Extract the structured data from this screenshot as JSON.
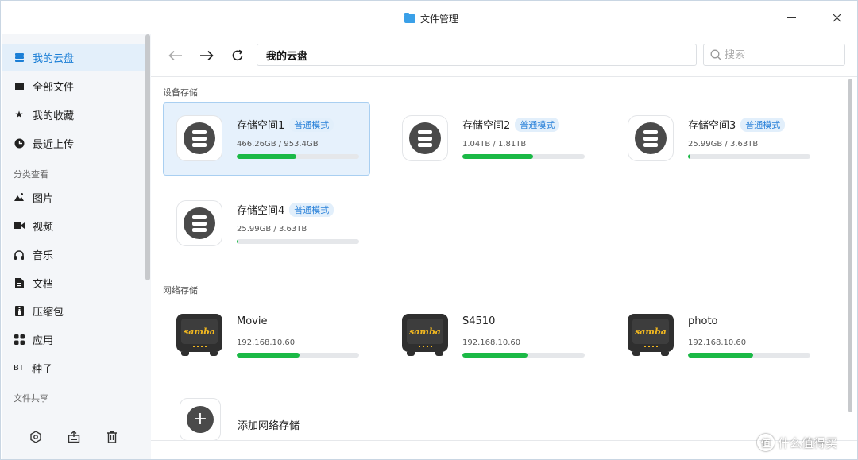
{
  "window": {
    "title": "文件管理"
  },
  "sidebar": {
    "items": [
      {
        "label": "我的云盘",
        "icon": "cloud-drive-icon",
        "active": true
      },
      {
        "label": "全部文件",
        "icon": "folder-icon"
      },
      {
        "label": "我的收藏",
        "icon": "star-icon"
      },
      {
        "label": "最近上传",
        "icon": "clock-icon"
      }
    ],
    "category_title": "分类查看",
    "categories": [
      {
        "label": "图片",
        "icon": "image-icon"
      },
      {
        "label": "视频",
        "icon": "video-icon"
      },
      {
        "label": "音乐",
        "icon": "headphones-icon"
      },
      {
        "label": "文档",
        "icon": "document-icon"
      },
      {
        "label": "压缩包",
        "icon": "archive-icon"
      },
      {
        "label": "应用",
        "icon": "apps-icon"
      },
      {
        "label": "种子",
        "icon": "torrent-icon",
        "icon_text": "BT"
      }
    ],
    "share_title": "文件共享"
  },
  "toolbar": {
    "path": "我的云盘",
    "search_placeholder": "搜索"
  },
  "device_section": {
    "label": "设备存储",
    "badge": "普通模式",
    "cards": [
      {
        "name": "存储空间1",
        "size": "466.26GB / 953.4GB",
        "usage": 0.49,
        "selected": true
      },
      {
        "name": "存储空间2",
        "size": "1.04TB / 1.81TB",
        "usage": 0.58
      },
      {
        "name": "存储空间3",
        "size": "25.99GB / 3.63TB",
        "usage": 0.01
      },
      {
        "name": "存储空间4",
        "size": "25.99GB / 3.63TB",
        "usage": 0.01
      }
    ]
  },
  "network_section": {
    "label": "网络存储",
    "logo_text": "samba",
    "cards": [
      {
        "name": "Movie",
        "ip": "192.168.10.60",
        "usage": 0.51
      },
      {
        "name": "S4510",
        "ip": "192.168.10.60",
        "usage": 0.53
      },
      {
        "name": "photo",
        "ip": "192.168.10.60",
        "usage": 0.53
      }
    ],
    "add_label": "添加网络存储"
  },
  "watermark": {
    "text": "什么值得买",
    "logo": "值"
  },
  "colors": {
    "accent": "#1c7fd6",
    "progress": "#1bb946",
    "badge_bg": "#e2effb"
  }
}
